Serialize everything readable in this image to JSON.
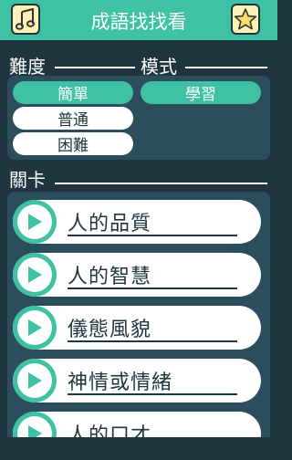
{
  "header": {
    "title": "成語找找看",
    "music_icon": "music-note-icon",
    "favorite_icon": "star-icon"
  },
  "difficulty": {
    "label": "難度",
    "options": [
      {
        "label": "簡單",
        "selected": true
      },
      {
        "label": "普通",
        "selected": false
      },
      {
        "label": "困難",
        "selected": false
      }
    ]
  },
  "mode": {
    "label": "模式",
    "options": [
      {
        "label": "學習",
        "selected": true
      }
    ]
  },
  "stages": {
    "label": "關卡",
    "items": [
      {
        "label": "人的品質"
      },
      {
        "label": "人的智慧"
      },
      {
        "label": "儀態風貌"
      },
      {
        "label": "神情或情緒"
      },
      {
        "label": "人的口才"
      }
    ]
  },
  "colors": {
    "accent": "#3fc2a4",
    "background": "#1f3540",
    "panel": "#2c4d5b",
    "icon_button": "#fbf1b4"
  }
}
